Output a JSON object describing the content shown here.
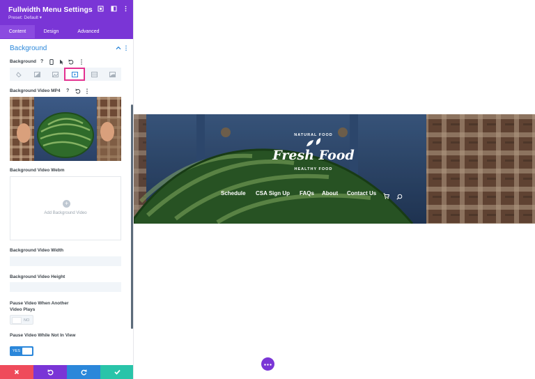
{
  "panel": {
    "title": "Fullwidth Menu Settings",
    "preset": "Preset: Default ▾",
    "tabs": [
      "Content",
      "Design",
      "Advanced"
    ],
    "section_title": "Background",
    "background_label": "Background",
    "bg_types": [
      "color-icon",
      "gradient-icon",
      "image-icon",
      "video-icon",
      "pattern-icon",
      "mask-icon"
    ],
    "bg_selected": "video-icon",
    "video_mp4_label": "Background Video MP4",
    "video_webm_label": "Background Video Webm",
    "add_video": "Add Background Video",
    "video_width_label": "Background Video Width",
    "video_height_label": "Background Video Height",
    "pause_other_label": "Pause Video When Another Video Plays",
    "pause_other_value": "NO",
    "pause_view_label": "Pause Video While Not In View",
    "pause_view_value": "YES"
  },
  "preview": {
    "logo_main": "Fresh Food",
    "logo_top": "NATURAL FOOD",
    "logo_bottom": "HEALTHY FOOD",
    "nav": [
      "Schedule",
      "CSA Sign Up",
      "FAQs",
      "About",
      "Contact Us"
    ]
  },
  "colors": {
    "header": "#7a35d6",
    "accent": "#2b87da",
    "cancel": "#ef4b5b",
    "undo": "#7a35d6",
    "redo": "#2b87da",
    "save": "#29c4a9"
  }
}
